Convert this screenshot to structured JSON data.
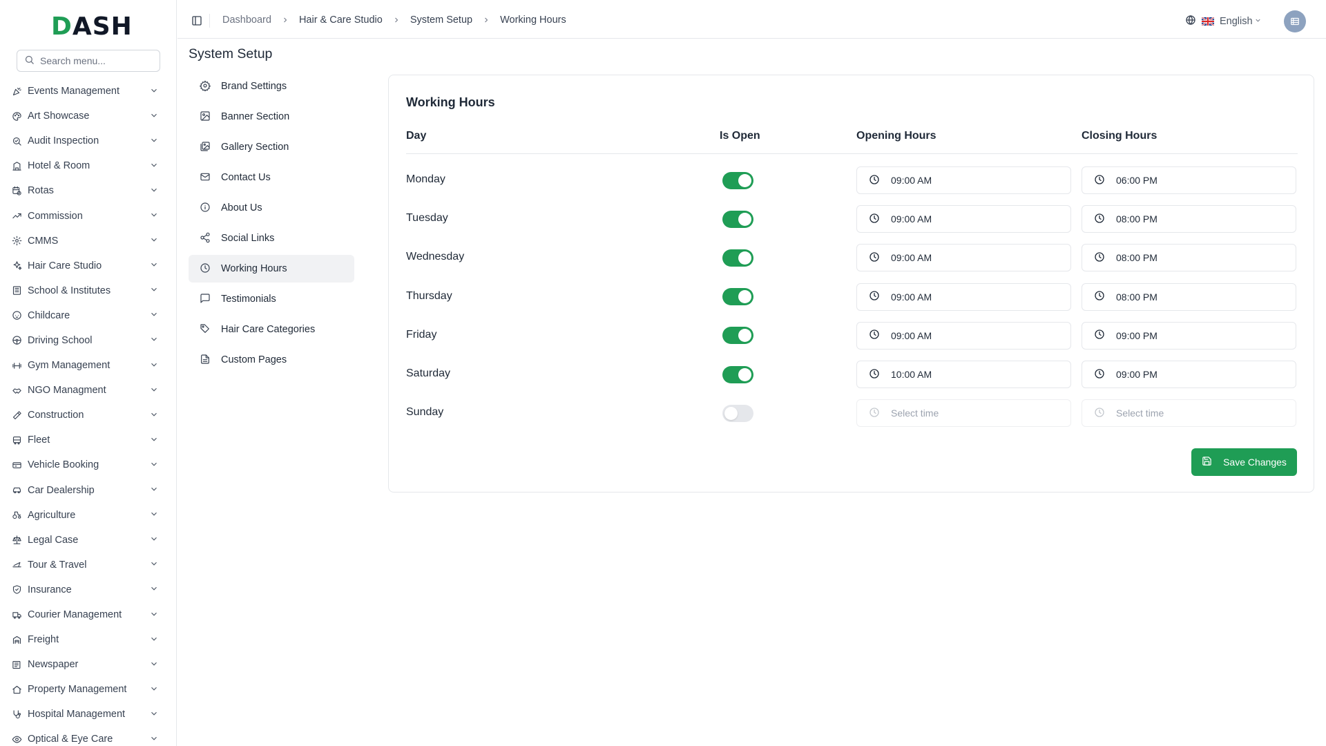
{
  "brand": {
    "logo_text": "DASH",
    "accent": "#1f9d55"
  },
  "sidebar": {
    "search_placeholder": "Search menu...",
    "items": [
      {
        "label": "Events Management",
        "icon": "party-popper-icon"
      },
      {
        "label": "Art Showcase",
        "icon": "palette-icon"
      },
      {
        "label": "Audit Inspection",
        "icon": "search-check-icon"
      },
      {
        "label": "Hotel & Room",
        "icon": "hotel-icon"
      },
      {
        "label": "Rotas",
        "icon": "calendar-clock-icon"
      },
      {
        "label": "Commission",
        "icon": "trending-up-icon"
      },
      {
        "label": "CMMS",
        "icon": "cog-icon"
      },
      {
        "label": "Hair Care Studio",
        "icon": "sparkles-icon"
      },
      {
        "label": "School & Institutes",
        "icon": "school-icon"
      },
      {
        "label": "Childcare",
        "icon": "baby-icon"
      },
      {
        "label": "Driving School",
        "icon": "steering-wheel-icon"
      },
      {
        "label": "Gym Management",
        "icon": "dumbbell-icon"
      },
      {
        "label": "NGO Managment",
        "icon": "handshake-icon"
      },
      {
        "label": "Construction",
        "icon": "hammer-icon"
      },
      {
        "label": "Fleet",
        "icon": "bus-icon"
      },
      {
        "label": "Vehicle Booking",
        "icon": "booking-icon"
      },
      {
        "label": "Car Dealership",
        "icon": "car-icon"
      },
      {
        "label": "Agriculture",
        "icon": "tractor-icon"
      },
      {
        "label": "Legal Case",
        "icon": "scale-icon"
      },
      {
        "label": "Tour & Travel",
        "icon": "plane-icon"
      },
      {
        "label": "Insurance",
        "icon": "shield-check-icon"
      },
      {
        "label": "Courier Management",
        "icon": "truck-icon"
      },
      {
        "label": "Freight",
        "icon": "container-icon"
      },
      {
        "label": "Newspaper",
        "icon": "newspaper-icon"
      },
      {
        "label": "Property Management",
        "icon": "house-icon"
      },
      {
        "label": "Hospital Management",
        "icon": "stethoscope-icon"
      },
      {
        "label": "Optical & Eye Care",
        "icon": "eye-icon"
      }
    ]
  },
  "topbar": {
    "breadcrumb": [
      "Dashboard",
      "Hair & Care Studio",
      "System Setup",
      "Working Hours"
    ],
    "language": "English"
  },
  "page": {
    "title": "System Setup"
  },
  "subnav": {
    "items": [
      {
        "label": "Brand Settings",
        "icon": "settings-icon"
      },
      {
        "label": "Banner Section",
        "icon": "image-icon"
      },
      {
        "label": "Gallery Section",
        "icon": "images-icon"
      },
      {
        "label": "Contact Us",
        "icon": "mail-icon"
      },
      {
        "label": "About Us",
        "icon": "info-icon"
      },
      {
        "label": "Social Links",
        "icon": "share-icon"
      },
      {
        "label": "Working Hours",
        "icon": "clock-icon"
      },
      {
        "label": "Testimonials",
        "icon": "message-square-icon"
      },
      {
        "label": "Hair Care Categories",
        "icon": "tag-icon"
      },
      {
        "label": "Custom Pages",
        "icon": "file-text-icon"
      }
    ],
    "active": "Working Hours"
  },
  "working_hours": {
    "title": "Working Hours",
    "headers": {
      "day": "Day",
      "is_open": "Is Open",
      "opening": "Opening Hours",
      "closing": "Closing Hours"
    },
    "rows": [
      {
        "day": "Monday",
        "open": true,
        "opening": "09:00 AM",
        "closing": "06:00 PM"
      },
      {
        "day": "Tuesday",
        "open": true,
        "opening": "09:00 AM",
        "closing": "08:00 PM"
      },
      {
        "day": "Wednesday",
        "open": true,
        "opening": "09:00 AM",
        "closing": "08:00 PM"
      },
      {
        "day": "Thursday",
        "open": true,
        "opening": "09:00 AM",
        "closing": "08:00 PM"
      },
      {
        "day": "Friday",
        "open": true,
        "opening": "09:00 AM",
        "closing": "09:00 PM"
      },
      {
        "day": "Saturday",
        "open": true,
        "opening": "10:00 AM",
        "closing": "09:00 PM"
      },
      {
        "day": "Sunday",
        "open": false,
        "opening": "Select time",
        "closing": "Select time"
      }
    ],
    "save_label": "Save Changes"
  }
}
